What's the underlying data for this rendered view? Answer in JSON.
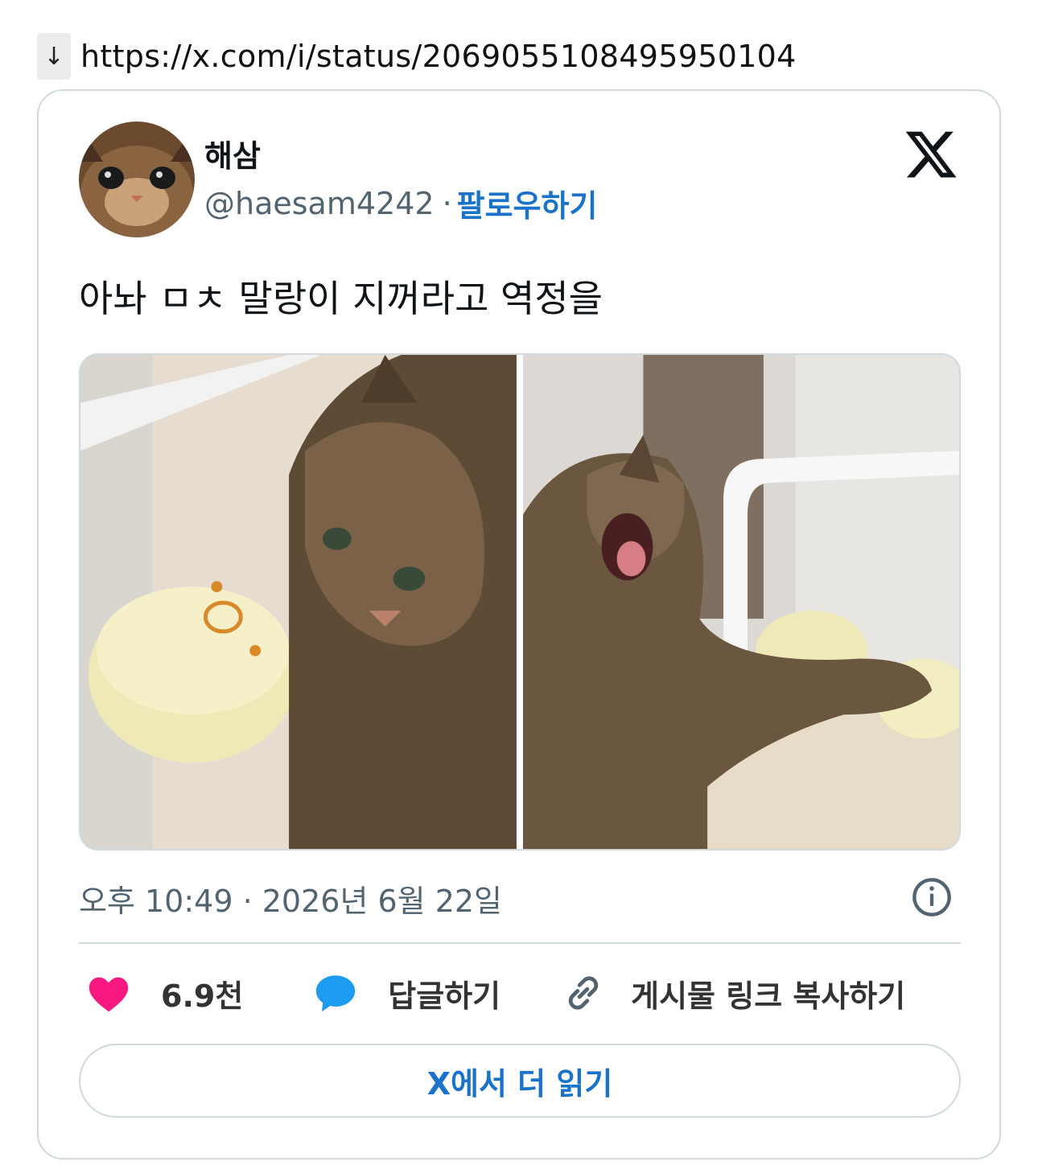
{
  "url_bar": {
    "arrow": "↓",
    "url": "https://x.com/i/status/2069055108495950104"
  },
  "tweet": {
    "display_name": "해삼",
    "handle": "@haesam4242",
    "separator": "·",
    "follow_label": "팔로우하기",
    "text": "아놔 ㅁㅊ 말랑이 지꺼라고 역정을",
    "timestamp": "오후 10:49 · 2026년 6월 22일",
    "media": [
      {
        "icon": "photo-cat-with-squishy-toy"
      },
      {
        "icon": "photo-cat-yawning-with-toy"
      }
    ],
    "actions": {
      "like_count": "6.9천",
      "reply_label": "답글하기",
      "copy_link_label": "게시물 링크 복사하기"
    },
    "read_more_label": "X에서 더 읽기"
  },
  "colors": {
    "accent": "#1a73c9",
    "heart": "#f91880",
    "reply_bubble": "#1d9bf0",
    "border": "#cfd9de",
    "muted_text": "#536471"
  }
}
